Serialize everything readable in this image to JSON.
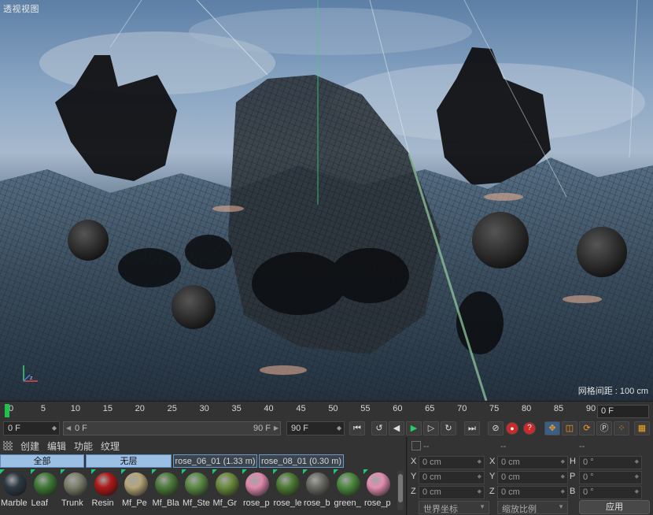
{
  "viewport": {
    "label": "透视视图",
    "grid_spacing": "网格间距 : 100 cm"
  },
  "timeline": {
    "ticks": [
      "0",
      "5",
      "10",
      "15",
      "20",
      "25",
      "30",
      "35",
      "40",
      "45",
      "50",
      "55",
      "60",
      "65",
      "70",
      "75",
      "80",
      "85",
      "90"
    ],
    "current_frame": "0 F"
  },
  "transport": {
    "start_field": "0 F",
    "range_start": "0 F",
    "range_end": "90 F",
    "end_field": "90 F",
    "buttons": [
      "go-to-start",
      "prev-key",
      "prev-frame",
      "play",
      "next-frame",
      "next-key",
      "go-to-end"
    ]
  },
  "material_manager": {
    "menu": [
      "创建",
      "编辑",
      "功能",
      "纹理"
    ],
    "filters": [
      "全部",
      "无层",
      "rose_06_01 (1.33 m)",
      "rose_08_01 (0.30 m)"
    ],
    "materials": [
      {
        "name": "Marble",
        "color": "#2e3a44"
      },
      {
        "name": "Leaf",
        "color": "#3f7a36"
      },
      {
        "name": "Trunk",
        "color": "#7c7f6a"
      },
      {
        "name": "Resin",
        "color": "#b01818"
      },
      {
        "name": "Mf_Pe",
        "color": "#b7a679"
      },
      {
        "name": "Mf_Bla",
        "color": "#4d7c3a"
      },
      {
        "name": "Mf_Ste",
        "color": "#5b8b45"
      },
      {
        "name": "Mf_Gr",
        "color": "#6a8c3c"
      },
      {
        "name": "rose_p",
        "color": "#e08aae"
      },
      {
        "name": "rose_le",
        "color": "#4e7c34"
      },
      {
        "name": "rose_b",
        "color": "#6b6b64"
      },
      {
        "name": "green_",
        "color": "#4c8a3e"
      },
      {
        "name": "rose_p",
        "color": "#e38fb2"
      }
    ]
  },
  "coordinates": {
    "headers": [
      "--",
      "--",
      "--"
    ],
    "rows": [
      {
        "a1": "X",
        "v1": "0 cm",
        "a2": "X",
        "v2": "0 cm",
        "a3": "H",
        "v3": "0 °"
      },
      {
        "a1": "Y",
        "v1": "0 cm",
        "a2": "Y",
        "v2": "0 cm",
        "a3": "P",
        "v3": "0 °"
      },
      {
        "a1": "Z",
        "v1": "0 cm",
        "a2": "Z",
        "v2": "0 cm",
        "a3": "B",
        "v3": "0 °"
      }
    ],
    "coord_system": "世界坐标",
    "scale_mode": "缩放比例",
    "apply": "应用"
  },
  "colors": {
    "accent_green": "#1fc24a",
    "filter_blue": "#9cc0e4",
    "record_red": "#cc2a2a"
  }
}
